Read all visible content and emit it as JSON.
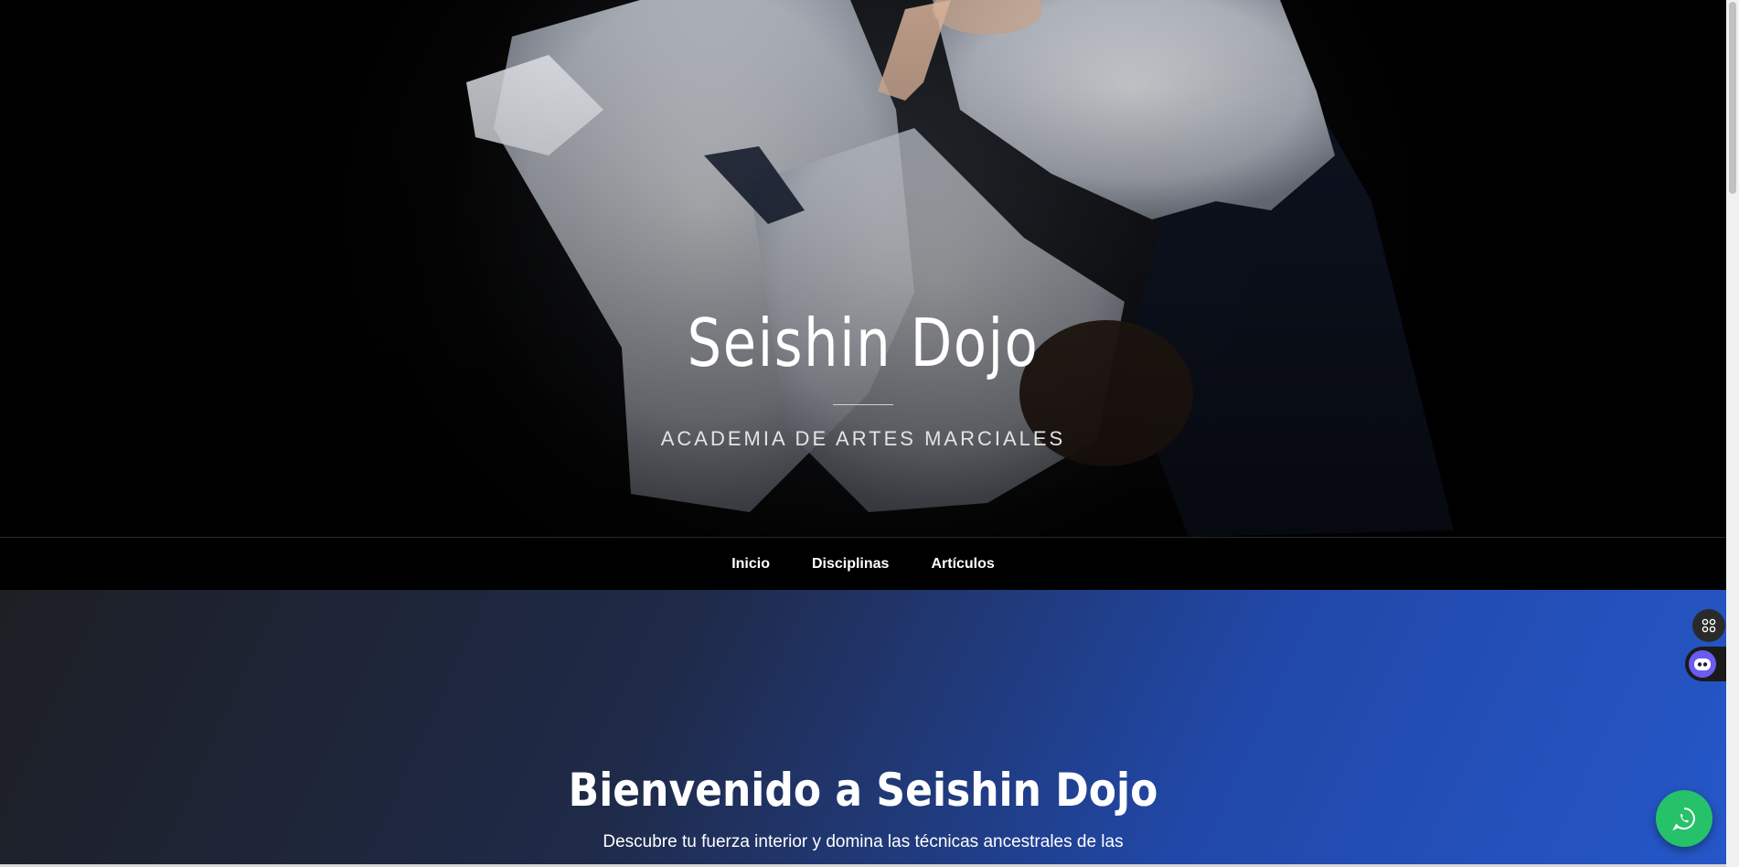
{
  "hero": {
    "title": "Seishin Dojo",
    "subtitle": "ACADEMIA DE ARTES MARCIALES"
  },
  "nav": {
    "items": [
      {
        "label": "Inicio"
      },
      {
        "label": "Disciplinas"
      },
      {
        "label": "Artículos"
      }
    ]
  },
  "welcome": {
    "title": "Bienvenido a Seishin Dojo",
    "text": "Descubre tu fuerza interior y domina las técnicas ancestrales de las"
  },
  "widgets": {
    "apps_icon": "apps-grid-icon",
    "robot_icon": "robot-icon",
    "whatsapp_icon": "whatsapp-icon"
  },
  "colors": {
    "accent_blue": "#2557c8",
    "whatsapp_green": "#25c26a",
    "robot_purple": "#6a5cf0"
  }
}
